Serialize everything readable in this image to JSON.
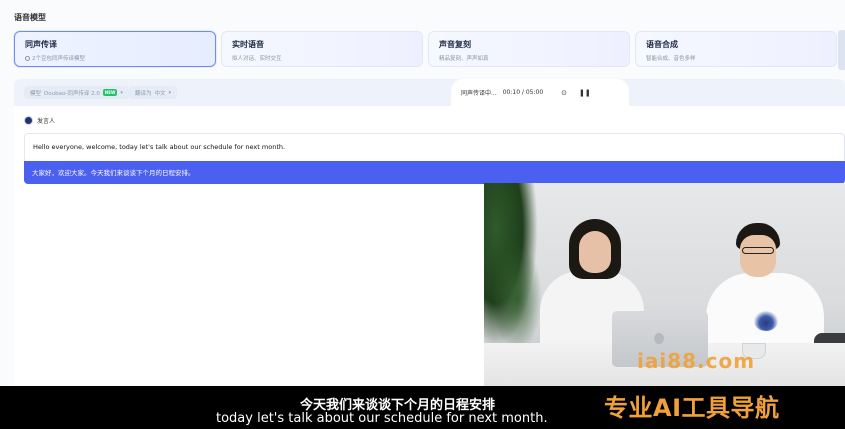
{
  "section_title": "语音模型",
  "cards": [
    {
      "title": "同声传译",
      "desc": "2个豆包同声传译模型",
      "active": true
    },
    {
      "title": "实时语音",
      "desc": "拟人对话、实时交互"
    },
    {
      "title": "声音复刻",
      "desc": "精品复刻、声声如真"
    },
    {
      "title": "语音合成",
      "desc": "智能合成、音色多样"
    }
  ],
  "toolbar": {
    "model_prefix": "模型",
    "model_value": "Doubao-同声传译 2.0",
    "model_badge": "NEW",
    "lang_prefix": "翻译为",
    "lang_value": "中文"
  },
  "player": {
    "label": "同声传译中...",
    "time": "00:10 / 05:00"
  },
  "speaker_label": "发言人",
  "source_text": "Hello everyone, welcome, today let's talk about our schedule for next month.",
  "target_text": "大家好，欢迎大家。今天我们来谈谈下个月的日程安排。",
  "watermark": "iai88.com",
  "subtitle": {
    "cn": "今天我们来谈谈下个月的日程安排",
    "en": "today let's talk about our schedule for next month."
  },
  "brand": "专业AI工具导航",
  "colors": {
    "accent": "#4b5ff0",
    "brand": "#f0a13a"
  }
}
